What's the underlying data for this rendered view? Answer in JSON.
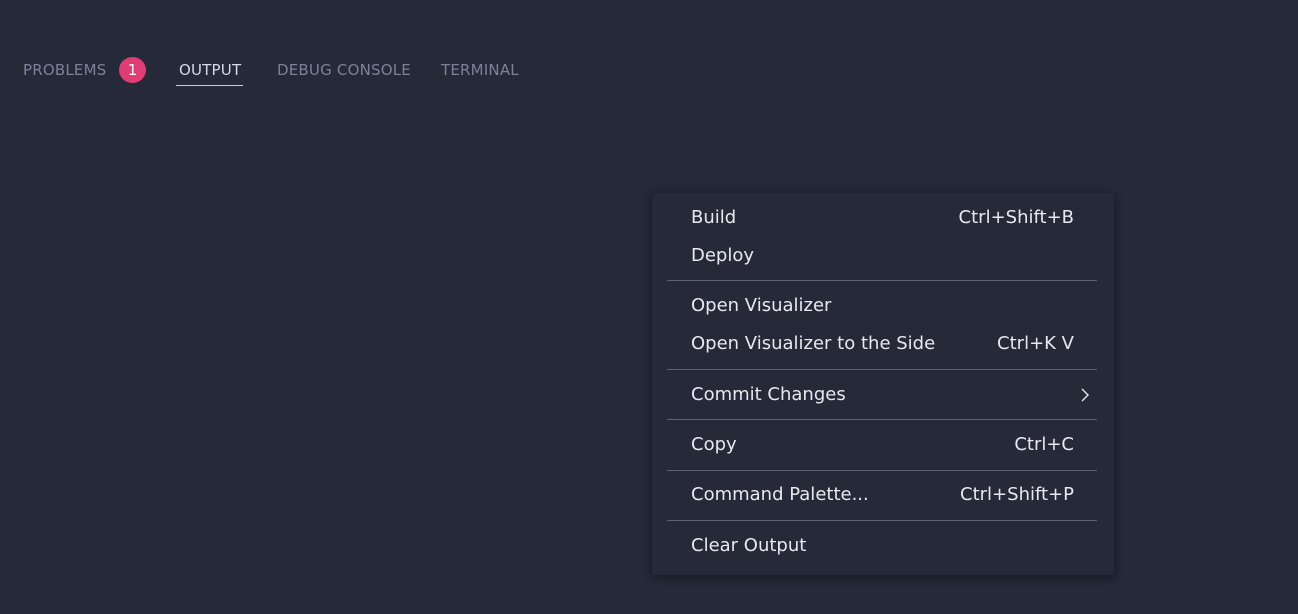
{
  "panel": {
    "tabs": [
      {
        "label": "PROBLEMS",
        "badge": "1"
      },
      {
        "label": "OUTPUT"
      },
      {
        "label": "DEBUG CONSOLE"
      },
      {
        "label": "TERMINAL"
      }
    ],
    "active_tab": "OUTPUT"
  },
  "context_menu": {
    "items": [
      {
        "label": "Build",
        "shortcut": "Ctrl+Shift+B"
      },
      {
        "label": "Deploy",
        "shortcut": ""
      },
      {
        "label": "Open Visualizer",
        "shortcut": ""
      },
      {
        "label": "Open Visualizer to the Side",
        "shortcut": "Ctrl+K V"
      },
      {
        "label": "Commit Changes",
        "submenu_icon": "chevron-right-icon"
      },
      {
        "label": "Copy",
        "shortcut": "Ctrl+C"
      },
      {
        "label": "Command Palette...",
        "shortcut": "Ctrl+Shift+P"
      },
      {
        "label": "Clear Output",
        "shortcut": ""
      }
    ]
  },
  "colors": {
    "background": "#252938",
    "badge": "#e03d74",
    "text": "#e8e9ef",
    "inactive_tab": "#7d8299",
    "separator": "#5a5f72"
  }
}
